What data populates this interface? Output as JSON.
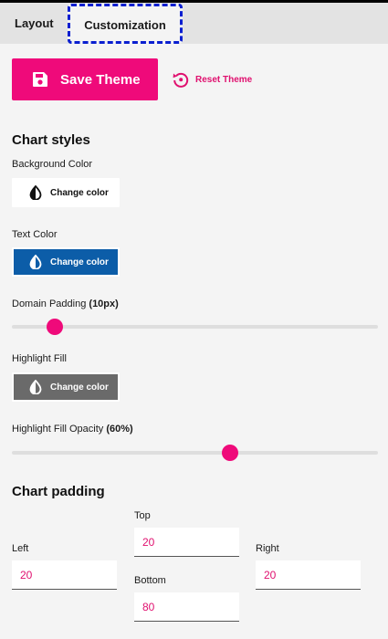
{
  "tabs": [
    {
      "label": "Layout"
    },
    {
      "label": "Customization"
    }
  ],
  "actions": {
    "save_label": "Save Theme",
    "reset_label": "Reset Theme"
  },
  "chart_styles": {
    "title": "Chart styles",
    "background_color": {
      "label": "Background Color",
      "button": "Change color",
      "swatch": "#ffffff"
    },
    "text_color": {
      "label": "Text Color",
      "button": "Change color",
      "swatch": "#0c5da8"
    },
    "domain_padding": {
      "label": "Domain Padding",
      "value_text": "(10px)",
      "value": 10,
      "max": 100
    },
    "highlight_fill": {
      "label": "Highlight Fill",
      "button": "Change color",
      "swatch": "#6a6a6a"
    },
    "highlight_fill_opacity": {
      "label": "Highlight Fill Opacity",
      "value_text": "(60%)",
      "value": 60,
      "max": 100
    }
  },
  "chart_padding": {
    "title": "Chart padding",
    "top": {
      "label": "Top",
      "value": "20"
    },
    "left": {
      "label": "Left",
      "value": "20"
    },
    "right": {
      "label": "Right",
      "value": "20"
    },
    "bottom": {
      "label": "Bottom",
      "value": "80"
    }
  },
  "colors": {
    "accent": "#ef0a7a",
    "focus_outline": "#0a1fd0"
  }
}
